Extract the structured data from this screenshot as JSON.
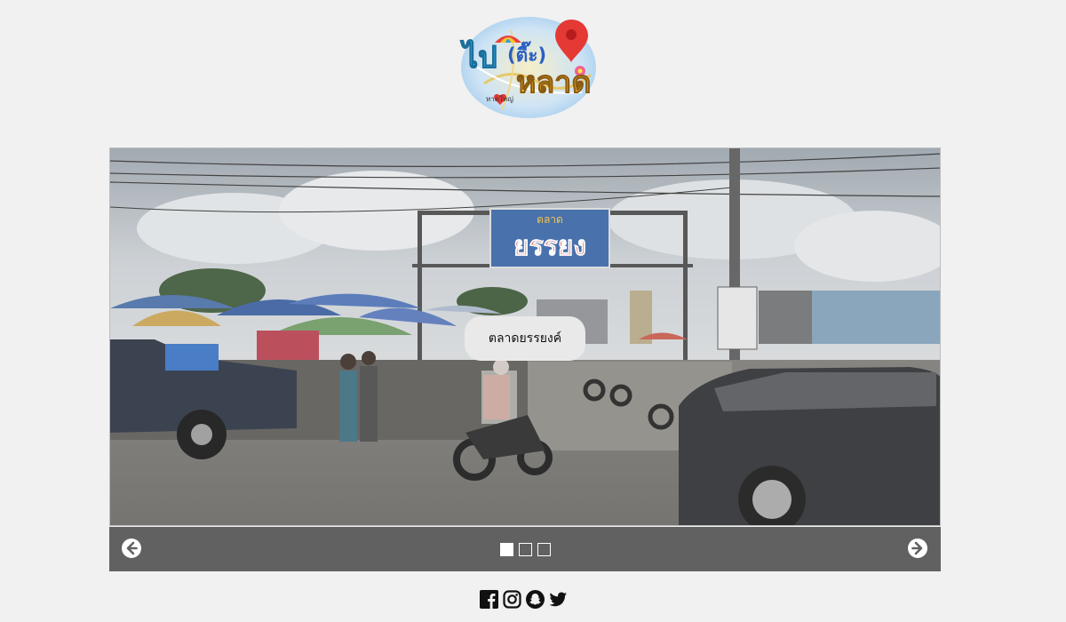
{
  "logo": {
    "line1": "ไป",
    "line2": "(ตี๊ะ)",
    "line3": "หลาด",
    "map_label": "หาดใหญ่"
  },
  "slideshow": {
    "caption": "ตลาดยรรยงค์",
    "sign_text": "ยรรยง",
    "sign_top": "ตลาด",
    "slide_count": 3,
    "active_slide": 1
  },
  "social": [
    "facebook-icon",
    "instagram-icon",
    "snapchat-icon",
    "twitter-icon"
  ],
  "colors": {
    "background": "#f1f1f1",
    "controls_bar": "#616161",
    "caption_bg": "#e9e9e9"
  }
}
